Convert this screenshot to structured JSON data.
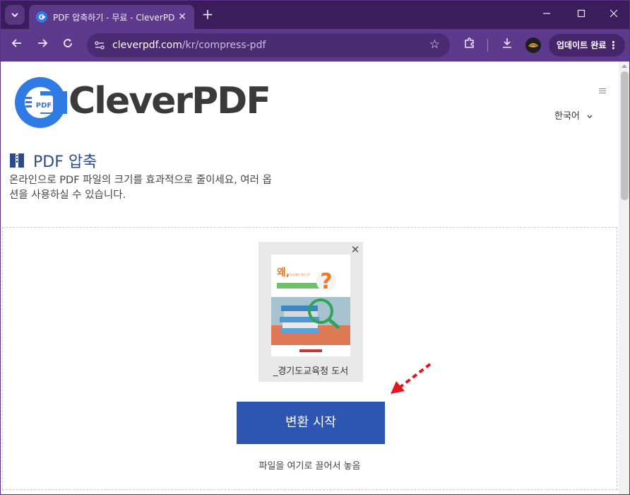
{
  "browser": {
    "tab": {
      "title": "PDF 압축하기 - 무료 - CleverPDF"
    },
    "url": {
      "domain": "cleverpdf.com",
      "path": "/kr/compress-pdf"
    },
    "update_button": "업데이트 완료"
  },
  "page": {
    "logo_text": "CleverPDF",
    "logo_badge": "PDF",
    "language": "한국어",
    "heading": "PDF 압축",
    "description_line1": "온라인으로 PDF 파일의 크기를 효과적으로 줄이세요, 여러 옵",
    "description_line2": "션을 사용하실 수 있습니다.",
    "file": {
      "name": "_경기도교육청 도서",
      "thumbnail_title": "왜,",
      "thumbnail_subtitle": "독서해야 하는가?"
    },
    "convert_button": "변환 시작",
    "drop_hint": "파일을 여기로 끌어서 놓음"
  },
  "colors": {
    "titlebar": "#3c1d5b",
    "toolbar": "#5e3a8c",
    "brand_blue": "#2d56b2",
    "heading": "#2b4a8c",
    "arrow": "#e3161b"
  },
  "icons": [
    "tab-menu-icon",
    "favicon-icon",
    "close-icon",
    "plus-icon",
    "minimize-icon",
    "maximize-icon",
    "back-icon",
    "forward-icon",
    "reload-icon",
    "site-info-icon",
    "star-icon",
    "extensions-icon",
    "download-icon",
    "more-icon",
    "hamburger-icon",
    "chevron-down-icon",
    "zipper-book-icon"
  ]
}
